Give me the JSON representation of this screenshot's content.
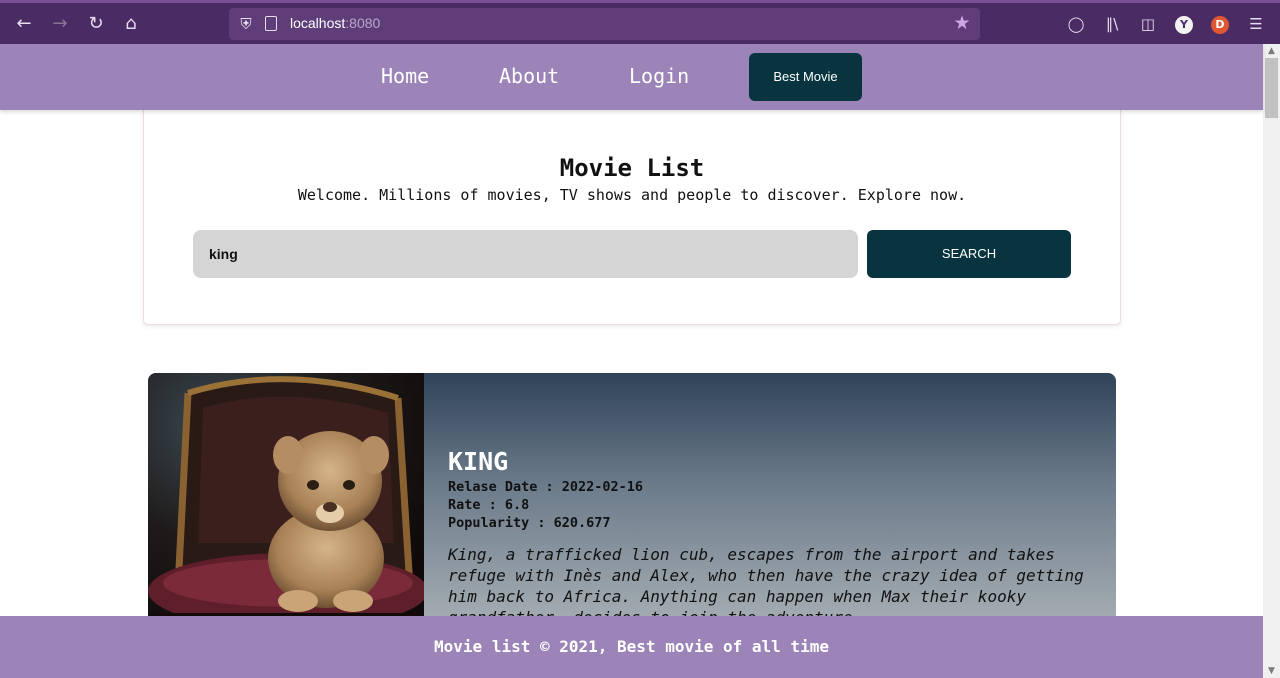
{
  "browser": {
    "url_host": "localhost",
    "url_port": ":8080",
    "icons": [
      "back-icon",
      "forward-icon",
      "reload-icon",
      "home-icon",
      "shield-icon",
      "page-icon",
      "bookmark-star-icon",
      "pocket-icon",
      "library-icon",
      "sidebar-icon",
      "yandex-icon",
      "duckduckgo-icon",
      "menu-icon"
    ],
    "accent": "#4a2b63"
  },
  "nav": {
    "links": [
      "Home",
      "About",
      "Login"
    ],
    "best_button": "Best Movie",
    "color": "#9c84b8"
  },
  "search": {
    "title": "Movie List",
    "subtitle": "Welcome. Millions of movies, TV shows and people to discover. Explore now.",
    "query": "king",
    "button": "SEARCH",
    "button_color": "#07343f"
  },
  "movie": {
    "title": "KING",
    "release": "Relase Date : 2022-02-16",
    "rate": "Rate : 6.8",
    "popularity": "Popularity : 620.677",
    "overview": "King, a trafficked lion cub, escapes from the airport and takes refuge with Inès and Alex, who then have the crazy idea of getting him back to Africa. Anything can happen when Max their kooky grandfather, decides to join the adventure."
  },
  "footer": {
    "text": "Movie list © 2021, Best movie of all time"
  }
}
